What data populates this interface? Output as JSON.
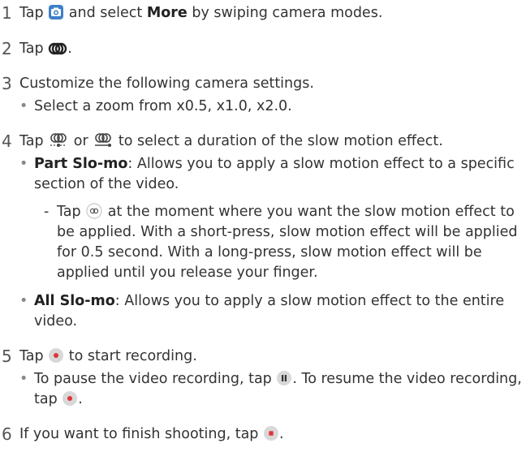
{
  "steps": [
    {
      "num": "1",
      "pre": "Tap",
      "icon": "camera-app-icon",
      "mid": "and select",
      "bold": "More",
      "post": "by swiping camera modes."
    },
    {
      "num": "2",
      "pre": "Tap",
      "icon": "slow-motion-icon",
      "post": "."
    },
    {
      "num": "3",
      "text": "Customize the following camera settings."
    },
    {
      "num": "4",
      "pre": "Tap",
      "icon1": "part-slomo-icon",
      "mid": "or",
      "icon2": "all-slomo-icon",
      "post": "to select a duration of the slow motion effect."
    },
    {
      "num": "5",
      "pre": "Tap",
      "icon": "record-icon",
      "post": "to start recording."
    },
    {
      "num": "6",
      "pre": "If you want to finish shooting, tap",
      "icon": "stop-icon",
      "post": "."
    }
  ],
  "step3_bullet": "Select a zoom from x0.5, x1.0, x2.0.",
  "part_slomo": {
    "label": "Part Slo-mo",
    "line1": ": Allows you to apply a slow motion effect to a specific",
    "line2": "section of the video."
  },
  "part_detail": {
    "pre": "Tap",
    "icon": "slomo-point-icon",
    "line1": "at the moment where you want the slow motion effect to",
    "line2": "be applied. With a short-press, slow motion effect will be applied",
    "line3": "for 0.5 second. With a long-press, slow motion effect will be",
    "line4": "applied until you release your finger."
  },
  "all_slomo": {
    "label": "All Slo-mo",
    "line1": ": Allows you to apply a slow motion effect to the entire",
    "line2": "video."
  },
  "pause_note": {
    "pre": "To pause the video recording, tap",
    "icon": "pause-icon",
    "mid": ". To resume the video recording,",
    "line2_pre": "tap",
    "icon2": "resume-icon",
    "post": "."
  },
  "bullet_glyph": "•",
  "dash_glyph": "-",
  "colors": {
    "text": "#333333",
    "camera_icon_bg": "#3d7fc7",
    "record_red": "#e0343c",
    "icon_gray": "#d8d8d8"
  }
}
